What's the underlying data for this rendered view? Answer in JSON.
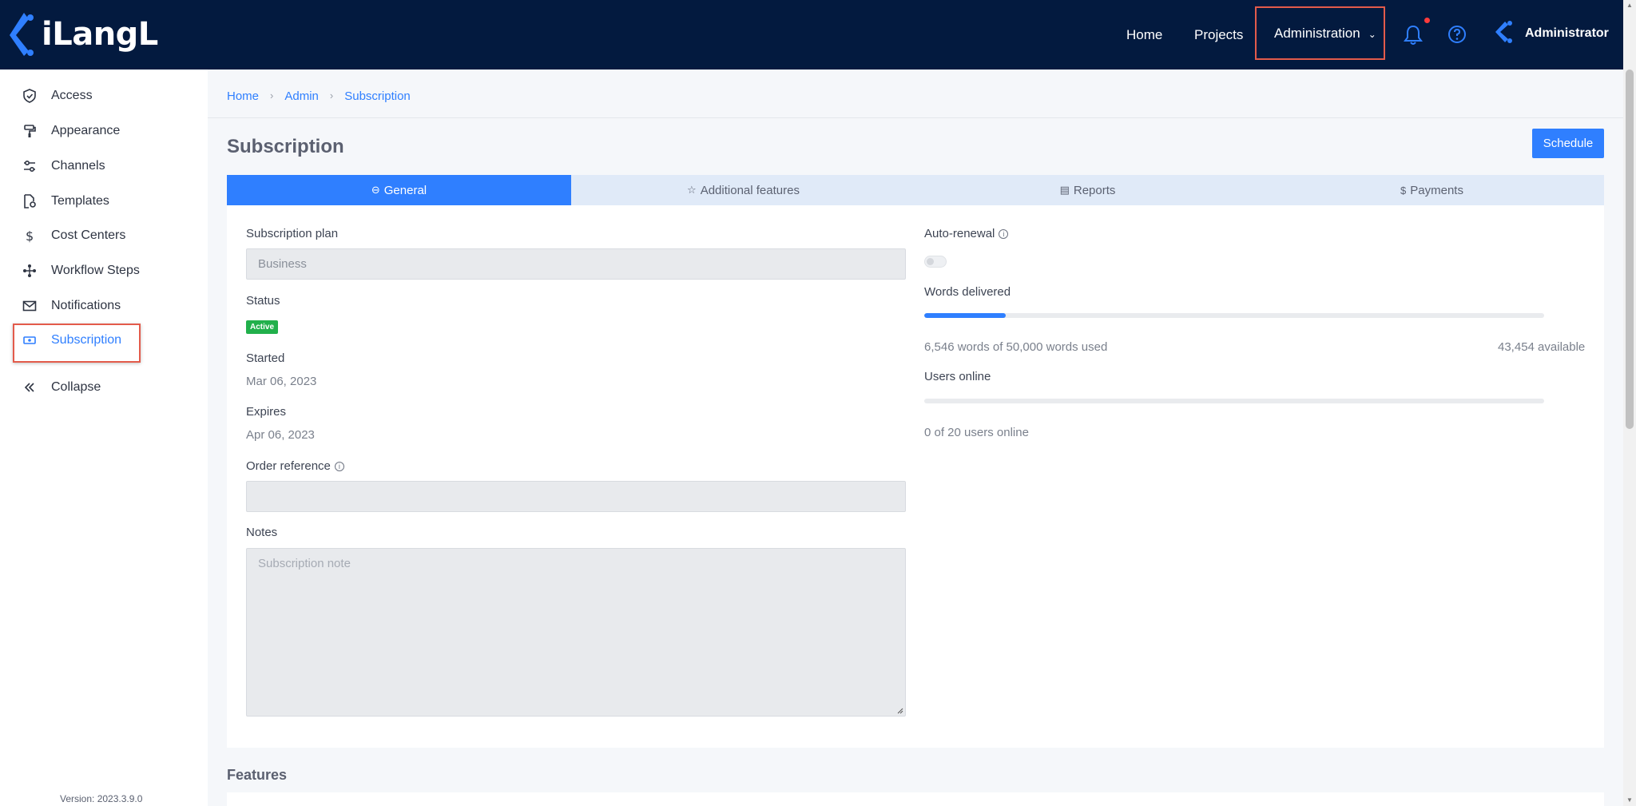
{
  "brand": {
    "name": "iLangL"
  },
  "topnav": {
    "home": "Home",
    "projects": "Projects",
    "administration": "Administration",
    "user": "Administrator"
  },
  "sidebar": {
    "items": [
      {
        "label": "Access",
        "icon": "shield-check-icon"
      },
      {
        "label": "Appearance",
        "icon": "paint-roller-icon"
      },
      {
        "label": "Channels",
        "icon": "sliders-icon"
      },
      {
        "label": "Templates",
        "icon": "file-gear-icon"
      },
      {
        "label": "Cost Centers",
        "icon": "dollar-icon"
      },
      {
        "label": "Workflow Steps",
        "icon": "workflow-icon"
      },
      {
        "label": "Notifications",
        "icon": "envelope-icon"
      },
      {
        "label": "Subscription",
        "icon": "ticket-icon",
        "active": true
      },
      {
        "label": "Collapse",
        "icon": "double-chevron-left-icon"
      }
    ],
    "version": "Version: 2023.3.9.0"
  },
  "breadcrumb": {
    "home": "Home",
    "admin": "Admin",
    "current": "Subscription"
  },
  "page": {
    "title": "Subscription",
    "schedule_button": "Schedule"
  },
  "tabs": [
    {
      "label": "General",
      "icon": "⊖",
      "active": true
    },
    {
      "label": "Additional features",
      "icon": "☆"
    },
    {
      "label": "Reports",
      "icon": "▤"
    },
    {
      "label": "Payments",
      "icon": "$"
    }
  ],
  "general": {
    "plan_label": "Subscription plan",
    "plan_value": "Business",
    "status_label": "Status",
    "status_value": "Active",
    "started_label": "Started",
    "started_value": "Mar 06, 2023",
    "expires_label": "Expires",
    "expires_value": "Apr 06, 2023",
    "order_label": "Order reference",
    "order_value": "",
    "notes_label": "Notes",
    "notes_placeholder": "Subscription note",
    "auto_renewal_label": "Auto-renewal",
    "auto_renewal_on": false,
    "words_label": "Words delivered",
    "words_used_text": "6,546 words of 50,000 words used",
    "words_available_text": "43,454 available",
    "words_fraction": 0.131,
    "users_label": "Users online",
    "users_text": "0 of 20 users online",
    "users_fraction": 0
  },
  "features": {
    "title": "Features"
  },
  "colors": {
    "accent": "#2f7fff",
    "header": "#031a3f",
    "active_badge": "#21b04b",
    "highlight": "#e35b4b"
  }
}
